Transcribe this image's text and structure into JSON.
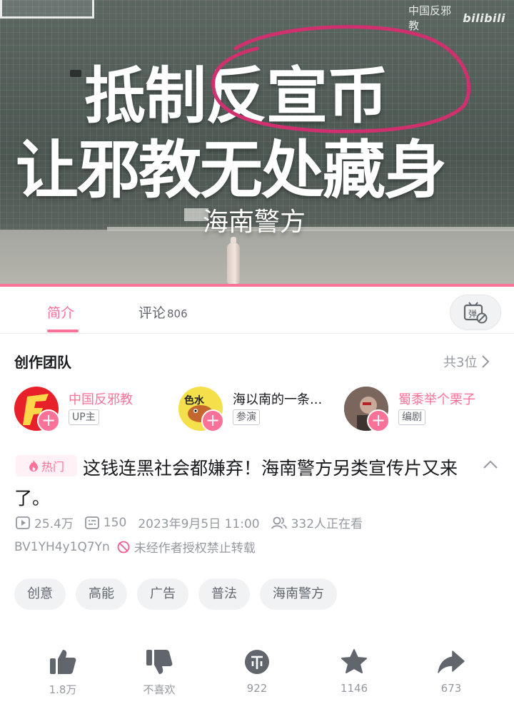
{
  "video": {
    "watermark_text": "中国反邪教",
    "watermark_logo": "bilibili",
    "overlay_line1": "抵制反宣币",
    "overlay_line2": "让邪教无处藏身",
    "overlay_line3": "海南警方",
    "annotation_color": "#d0306e"
  },
  "tabs": [
    {
      "label": "简介",
      "active": true
    },
    {
      "label": "评论",
      "count": "806",
      "active": false
    }
  ],
  "danmaku_button": {
    "icon": "danmaku-off-icon",
    "glyph": "弹"
  },
  "team": {
    "header": "创作团队",
    "count_label": "共3位",
    "members": [
      {
        "name": "中国反邪教",
        "role": "UP主",
        "avatar_icon": "flame-logo-avatar"
      },
      {
        "name": "海以南的一条...",
        "role": "参演",
        "avatar_icon": "cartoon-fish-avatar"
      },
      {
        "name": "蜀黍举个栗子",
        "role": "编剧",
        "avatar_icon": "photo-avatar"
      }
    ]
  },
  "video_info": {
    "hot_badge": "热门",
    "title": "这钱连黑社会都嫌弃！海南警方另类宣传片又来了。",
    "views": "25.4万",
    "danmaku_count": "150",
    "publish_time": "2023年9月5日 11:00",
    "watching": "332人正在看",
    "bvid": "BV1YH4y1Q7Yn",
    "repost_notice": "未经作者授权禁止转载"
  },
  "tags": [
    "创意",
    "高能",
    "广告",
    "普法",
    "海南警方"
  ],
  "actions": [
    {
      "name": "like",
      "icon": "thumbs-up-icon",
      "label": "1.8万"
    },
    {
      "name": "dislike",
      "icon": "thumbs-down-icon",
      "label": "不喜欢"
    },
    {
      "name": "coin",
      "icon": "coin-icon",
      "label": "922"
    },
    {
      "name": "favorite",
      "icon": "star-icon",
      "label": "1146"
    },
    {
      "name": "share",
      "icon": "share-icon",
      "label": "673"
    }
  ],
  "colors": {
    "accent": "#fb7299",
    "text_secondary": "#9499a0",
    "tag_bg": "#f1f2f3"
  }
}
